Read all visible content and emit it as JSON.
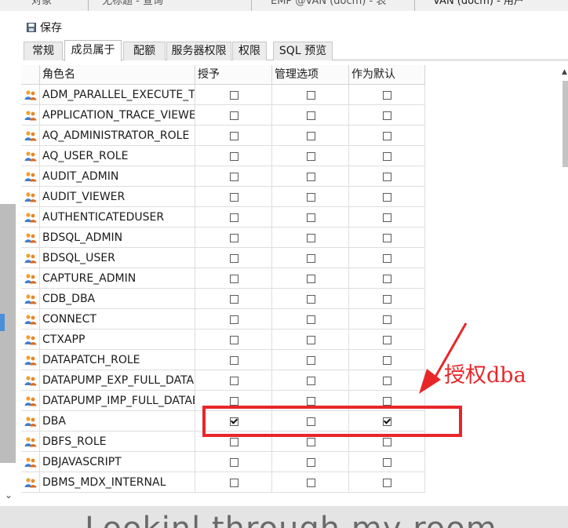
{
  "top_tabs": [
    {
      "label": "对象"
    },
    {
      "label": "无标题 - 查询"
    },
    {
      "label": "EMP @VAN (docm) - 表"
    },
    {
      "label": "VAN (docm) - 用户"
    }
  ],
  "toolbar": {
    "save_label": "保存"
  },
  "tabs": [
    {
      "label": "常规",
      "active": false
    },
    {
      "label": "成员属于",
      "active": true
    },
    {
      "label": "配额",
      "active": false
    },
    {
      "label": "服务器权限",
      "active": false
    },
    {
      "label": "权限",
      "active": false
    },
    {
      "label": "SQL 预览",
      "active": false
    }
  ],
  "columns": {
    "role_name": "角色名",
    "granted": "授予",
    "admin_option": "管理选项",
    "default": "作为默认"
  },
  "rows": [
    {
      "name": "ADM_PARALLEL_EXECUTE_TASK",
      "granted": false,
      "admin": false,
      "default": false
    },
    {
      "name": "APPLICATION_TRACE_VIEWER",
      "granted": false,
      "admin": false,
      "default": false
    },
    {
      "name": "AQ_ADMINISTRATOR_ROLE",
      "granted": false,
      "admin": false,
      "default": false
    },
    {
      "name": "AQ_USER_ROLE",
      "granted": false,
      "admin": false,
      "default": false
    },
    {
      "name": "AUDIT_ADMIN",
      "granted": false,
      "admin": false,
      "default": false
    },
    {
      "name": "AUDIT_VIEWER",
      "granted": false,
      "admin": false,
      "default": false
    },
    {
      "name": "AUTHENTICATEDUSER",
      "granted": false,
      "admin": false,
      "default": false
    },
    {
      "name": "BDSQL_ADMIN",
      "granted": false,
      "admin": false,
      "default": false
    },
    {
      "name": "BDSQL_USER",
      "granted": false,
      "admin": false,
      "default": false
    },
    {
      "name": "CAPTURE_ADMIN",
      "granted": false,
      "admin": false,
      "default": false
    },
    {
      "name": "CDB_DBA",
      "granted": false,
      "admin": false,
      "default": false
    },
    {
      "name": "CONNECT",
      "granted": false,
      "admin": false,
      "default": false
    },
    {
      "name": "CTXAPP",
      "granted": false,
      "admin": false,
      "default": false
    },
    {
      "name": "DATAPATCH_ROLE",
      "granted": false,
      "admin": false,
      "default": false
    },
    {
      "name": "DATAPUMP_EXP_FULL_DATABASE",
      "granted": false,
      "admin": false,
      "default": false
    },
    {
      "name": "DATAPUMP_IMP_FULL_DATABASE",
      "granted": false,
      "admin": false,
      "default": false
    },
    {
      "name": "DBA",
      "granted": true,
      "admin": false,
      "default": true
    },
    {
      "name": "DBFS_ROLE",
      "granted": false,
      "admin": false,
      "default": false
    },
    {
      "name": "DBJAVASCRIPT",
      "granted": false,
      "admin": false,
      "default": false
    },
    {
      "name": "DBMS_MDX_INTERNAL",
      "granted": false,
      "admin": false,
      "default": false
    }
  ],
  "annotation": {
    "text": "授权dba",
    "color": "#e8262a"
  },
  "footer": {
    "caption": "Lookinl through my room"
  },
  "icons": {
    "save": "save-disk-icon",
    "role": "role-users-icon"
  }
}
